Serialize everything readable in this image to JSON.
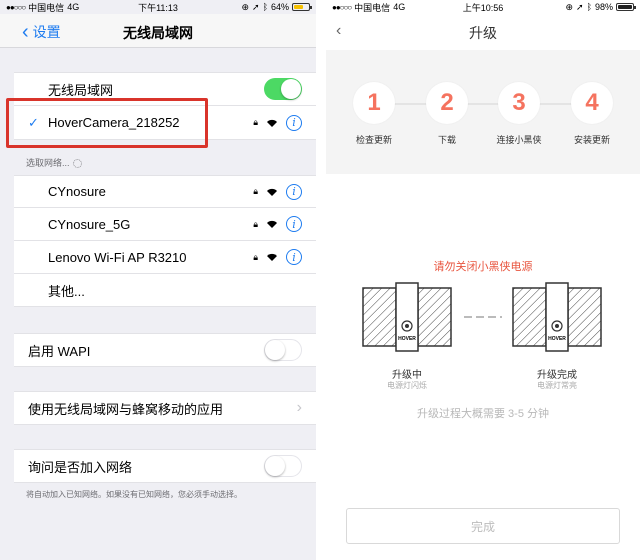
{
  "left": {
    "status": {
      "signal": "●●○○○",
      "carrier": "中国电信",
      "network": "4G",
      "time": "下午11:13",
      "battery": "64%",
      "battery_level": 0.64,
      "battery_color": "#f5c000"
    },
    "nav": {
      "back": "设置",
      "title": "无线局域网"
    },
    "wlan_label": "无线局域网",
    "wlan_on": true,
    "connected": {
      "check": "✓",
      "name": "HoverCamera_218252"
    },
    "choose_label": "选取网络...",
    "networks": [
      {
        "name": "CYnosure"
      },
      {
        "name": "CYnosure_5G"
      },
      {
        "name": "Lenovo Wi-Fi AP R3210"
      }
    ],
    "other": "其他...",
    "wapi_label": "启用 WAPI",
    "apps_label": "使用无线局域网与蜂窝移动的应用",
    "ask_label": "询问是否加入网络",
    "ask_footer": "将自动加入已知网络。如果没有已知网络，您必须手动选择。"
  },
  "right": {
    "status": {
      "signal": "●●○○○",
      "carrier": "中国电信",
      "network": "4G",
      "time": "上午10:56",
      "battery": "98%",
      "battery_level": 0.98,
      "battery_color": "#222222"
    },
    "nav": {
      "back": "‹",
      "title": "升级"
    },
    "steps": [
      {
        "num": "1",
        "label": "检查更新"
      },
      {
        "num": "2",
        "label": "下载"
      },
      {
        "num": "3",
        "label": "连接小黑侠"
      },
      {
        "num": "4",
        "label": "安装更新"
      }
    ],
    "accent": "#f5735f",
    "warning": "请勿关闭小黑侠电源",
    "device_brand": "HOVER",
    "device_left": {
      "title": "升级中",
      "sub": "电源灯闪烁"
    },
    "device_right": {
      "title": "升级完成",
      "sub": "电源灯常亮"
    },
    "time_text": "升级过程大概需要 3-5 分钟",
    "done": "完成"
  }
}
